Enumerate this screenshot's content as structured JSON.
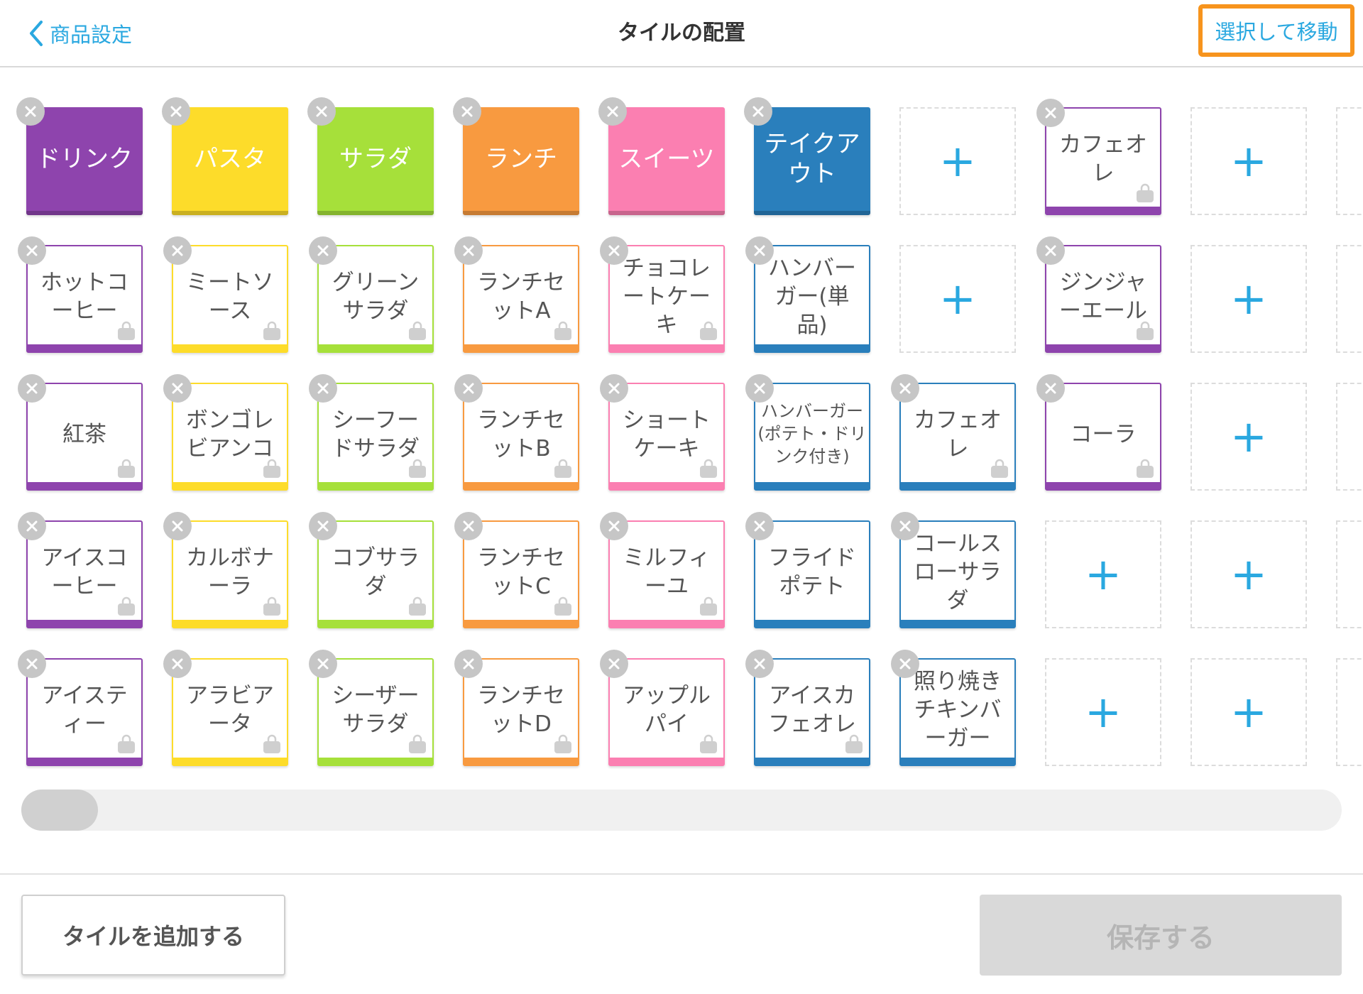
{
  "header": {
    "back_label": "商品設定",
    "title": "タイルの配置",
    "select_move_label": "選択して移動"
  },
  "colors": {
    "accent": "#2aa8e0",
    "highlight": "#f7941d",
    "purple": "#8e44ad",
    "yellow": "#fddc2a",
    "green": "#a6e03a",
    "orange": "#f89a40",
    "pink": "#fb7fb1",
    "blue": "#2a7fbc"
  },
  "grid": {
    "rows": [
      [
        {
          "type": "category",
          "label": "ドリンク",
          "color": "#8e44ad"
        },
        {
          "type": "category",
          "label": "パスタ",
          "color": "#fddc2a"
        },
        {
          "type": "category",
          "label": "サラダ",
          "color": "#a6e03a"
        },
        {
          "type": "category",
          "label": "ランチ",
          "color": "#f89a40"
        },
        {
          "type": "category",
          "label": "スイーツ",
          "color": "#fb7fb1"
        },
        {
          "type": "category",
          "label": "テイクアウト",
          "color": "#2a7fbc"
        },
        {
          "type": "empty"
        },
        {
          "type": "item",
          "label": "カフェオレ",
          "color": "#8e44ad",
          "bag": true
        },
        {
          "type": "empty"
        },
        {
          "type": "empty"
        }
      ],
      [
        {
          "type": "item",
          "label": "ホットコーヒー",
          "color": "#8e44ad",
          "bag": true
        },
        {
          "type": "item",
          "label": "ミートソース",
          "color": "#fddc2a",
          "bag": true
        },
        {
          "type": "item",
          "label": "グリーンサラダ",
          "color": "#a6e03a",
          "bag": true
        },
        {
          "type": "item",
          "label": "ランチセットA",
          "color": "#f89a40",
          "bag": true
        },
        {
          "type": "item",
          "label": "チョコレートケーキ",
          "color": "#fb7fb1",
          "bag": true
        },
        {
          "type": "item",
          "label": "ハンバーガー(単品)",
          "color": "#2a7fbc",
          "bag": false
        },
        {
          "type": "empty"
        },
        {
          "type": "item",
          "label": "ジンジャーエール",
          "color": "#8e44ad",
          "bag": true
        },
        {
          "type": "empty"
        },
        {
          "type": "empty"
        }
      ],
      [
        {
          "type": "item",
          "label": "紅茶",
          "color": "#8e44ad",
          "bag": true
        },
        {
          "type": "item",
          "label": "ボンゴレビアンコ",
          "color": "#fddc2a",
          "bag": true
        },
        {
          "type": "item",
          "label": "シーフードサラダ",
          "color": "#a6e03a",
          "bag": true
        },
        {
          "type": "item",
          "label": "ランチセットB",
          "color": "#f89a40",
          "bag": true
        },
        {
          "type": "item",
          "label": "ショートケーキ",
          "color": "#fb7fb1",
          "bag": true
        },
        {
          "type": "item",
          "label": "ハンバーガー(ポテト・ドリンク付き)",
          "color": "#2a7fbc",
          "bag": false,
          "small": true
        },
        {
          "type": "item",
          "label": "カフェオレ",
          "color": "#2a7fbc",
          "bag": true
        },
        {
          "type": "item",
          "label": "コーラ",
          "color": "#8e44ad",
          "bag": true
        },
        {
          "type": "empty"
        },
        {
          "type": "empty"
        }
      ],
      [
        {
          "type": "item",
          "label": "アイスコーヒー",
          "color": "#8e44ad",
          "bag": true
        },
        {
          "type": "item",
          "label": "カルボナーラ",
          "color": "#fddc2a",
          "bag": true
        },
        {
          "type": "item",
          "label": "コブサラダ",
          "color": "#a6e03a",
          "bag": true
        },
        {
          "type": "item",
          "label": "ランチセットC",
          "color": "#f89a40",
          "bag": true
        },
        {
          "type": "item",
          "label": "ミルフィーユ",
          "color": "#fb7fb1",
          "bag": true
        },
        {
          "type": "item",
          "label": "フライドポテト",
          "color": "#2a7fbc",
          "bag": false
        },
        {
          "type": "item",
          "label": "コールスローサラダ",
          "color": "#2a7fbc",
          "bag": false
        },
        {
          "type": "empty"
        },
        {
          "type": "empty"
        },
        {
          "type": "empty"
        }
      ],
      [
        {
          "type": "item",
          "label": "アイスティー",
          "color": "#8e44ad",
          "bag": true
        },
        {
          "type": "item",
          "label": "アラビアータ",
          "color": "#fddc2a",
          "bag": true
        },
        {
          "type": "item",
          "label": "シーザーサラダ",
          "color": "#a6e03a",
          "bag": true
        },
        {
          "type": "item",
          "label": "ランチセットD",
          "color": "#f89a40",
          "bag": true
        },
        {
          "type": "item",
          "label": "アップルパイ",
          "color": "#fb7fb1",
          "bag": true
        },
        {
          "type": "item",
          "label": "アイスカフェオレ",
          "color": "#2a7fbc",
          "bag": true
        },
        {
          "type": "item",
          "label": "照り焼きチキンバーガー",
          "color": "#2a7fbc",
          "bag": false
        },
        {
          "type": "empty"
        },
        {
          "type": "empty"
        },
        {
          "type": "empty"
        }
      ]
    ]
  },
  "scrollbar": {
    "position": 0
  },
  "footer": {
    "add_tile_label": "タイルを追加する",
    "save_label": "保存する"
  }
}
